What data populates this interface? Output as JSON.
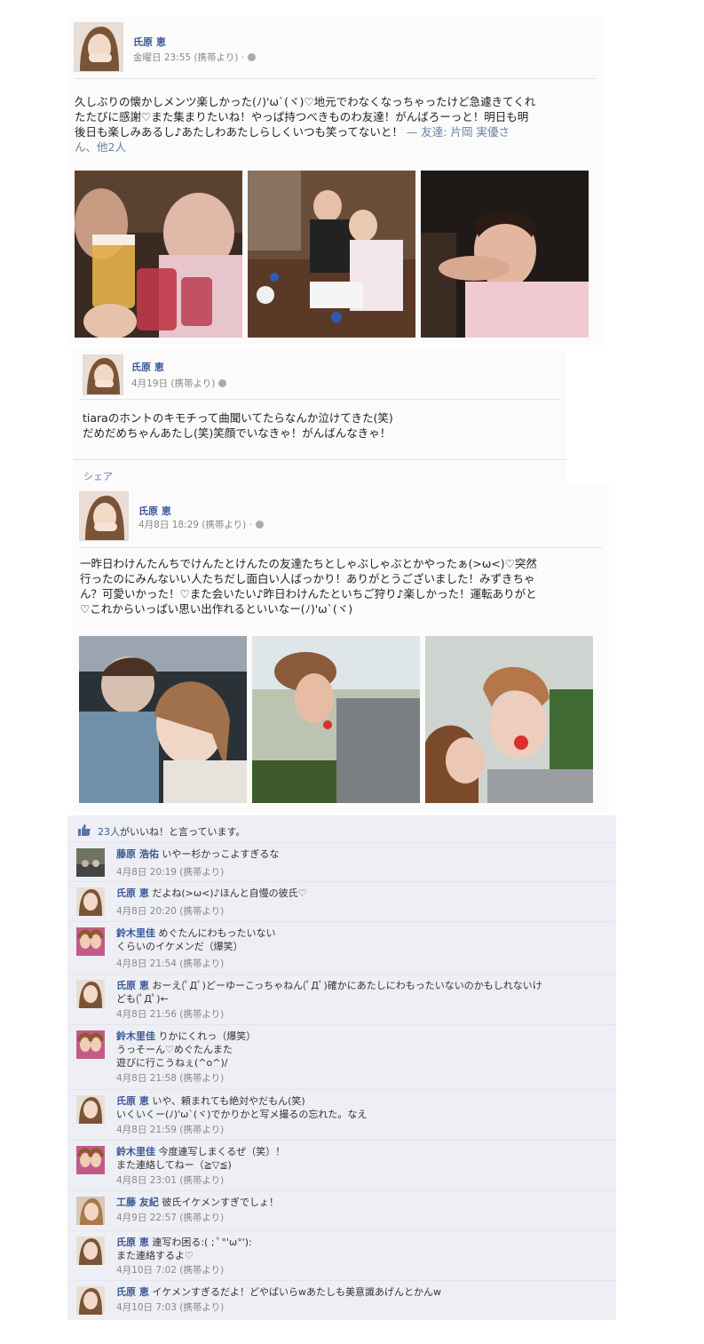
{
  "post1": {
    "author": "氏原 恵",
    "meta": "金曜日 23:55 (携帯より) ·",
    "text_line1": "久しぶりの懐かしメンツ楽しかった(ﾉ)'ω`(ヾ)♡地元でわなくなっちゃったけど急遽きてくれ",
    "text_line2": "たたびに感謝♡また集まりたいね！やっぱ持つべきものわ友達！がんばろーっと！明日も明",
    "text_line3": "後日も楽しみあるし♪あたしわあたしらしくいつも笑ってないと！ ",
    "tagged_prefix": "— 友達: 片岡 実優さ",
    "tagged_suffix": "ん、他2人"
  },
  "post2": {
    "author": "氏原 恵",
    "meta": "4月19日 (携帯より)",
    "text_line1": "tiaraのホントのキモチって曲聞いてたらなんか泣けてきた(笑)",
    "text_line2": "だめだめちゃんあたし(笑)笑顔でいなきゃ！がんばんなきゃ！",
    "share_label": "シェア"
  },
  "post3": {
    "author": "氏原 恵",
    "meta": "4月8日 18:29 (携帯より) ·",
    "text_line1": "一昨日わけんたんちでけんたとけんたの友達たちとしゃぶしゃぶとかやったぁ(>ω<)♡突然",
    "text_line2": "行ったのにみんないい人たちだし面白い人ばっかり！ありがとうございました！みずきちゃ",
    "text_line3": "ん？可愛いかった！♡また会いたい♪昨日わけんたといちご狩り♪楽しかった！運転ありがと",
    "text_line4": "♡これからいっぱい思い出作れるといいなー(ﾉ)'ω`(ヾ)"
  },
  "likes": {
    "count": "23人",
    "suffix": "がいいね！と言っています。"
  },
  "comments": [
    {
      "name": "藤原 浩佑",
      "line1": "いやー杉かっこよすぎるな",
      "line2": "",
      "line3": "",
      "time": "4月8日 20:19 (携帯より)"
    },
    {
      "name": "氏原 恵",
      "line1": "だよね(>ω<)♪ほんと自慢の彼氏♡",
      "line2": "",
      "line3": "",
      "time": "4月8日 20:20 (携帯より)"
    },
    {
      "name": "鈴木里佳",
      "line1": "めぐたんにわもったいない",
      "line2": "くらいのイケメンだ（爆笑）",
      "line3": "",
      "time": "4月8日 21:54 (携帯より)"
    },
    {
      "name": "氏原 恵",
      "line1": "おーえ(ﾟДﾟ)どーゆーこっちゃねん(ﾟДﾟ)確かにあたしにわもったいないのかもしれないけ",
      "line2": "ども(ﾟДﾟ)←",
      "line3": "",
      "time": "4月8日 21:56 (携帯より)"
    },
    {
      "name": "鈴木里佳",
      "line1": "りかにくれっ（爆笑）",
      "line2": "うっそーん♡めぐたんまた",
      "line3": "遊びに行こうねぇ(^o^)/",
      "time": "4月8日 21:58 (携帯より)"
    },
    {
      "name": "氏原 恵",
      "line1": "いや、頼まれても絶対やだもん(笑)",
      "line2": "いくいくー(ﾉ)'ω`(ヾ)でかりかと写メ撮るの忘れた。なえ",
      "line3": "",
      "time": "4月8日 21:59 (携帯より)"
    },
    {
      "name": "鈴木里佳",
      "line1": "今度連写しまくるぜ（笑）！",
      "line2": "また連絡してねー（≧▽≦)",
      "line3": "",
      "time": "4月8日 23:01 (携帯より)"
    },
    {
      "name": "工藤 友紀",
      "line1": "彼氏イケメンすぎでしょ！",
      "line2": "",
      "line3": "",
      "time": "4月9日 22:57 (携帯より)"
    },
    {
      "name": "氏原 恵",
      "line1": "連写わ困る:( ; ﾟ°'ω°'):",
      "line2": "また連絡するよ♡",
      "line3": "",
      "time": "4月10日 7:02 (携帯より)"
    },
    {
      "name": "氏原 恵",
      "line1": "イケメンすぎるだよ！どやばいらwあたしも美意識あげんとかんw",
      "line2": "",
      "line3": "",
      "time": "4月10日 7:03 (携帯より)"
    }
  ]
}
